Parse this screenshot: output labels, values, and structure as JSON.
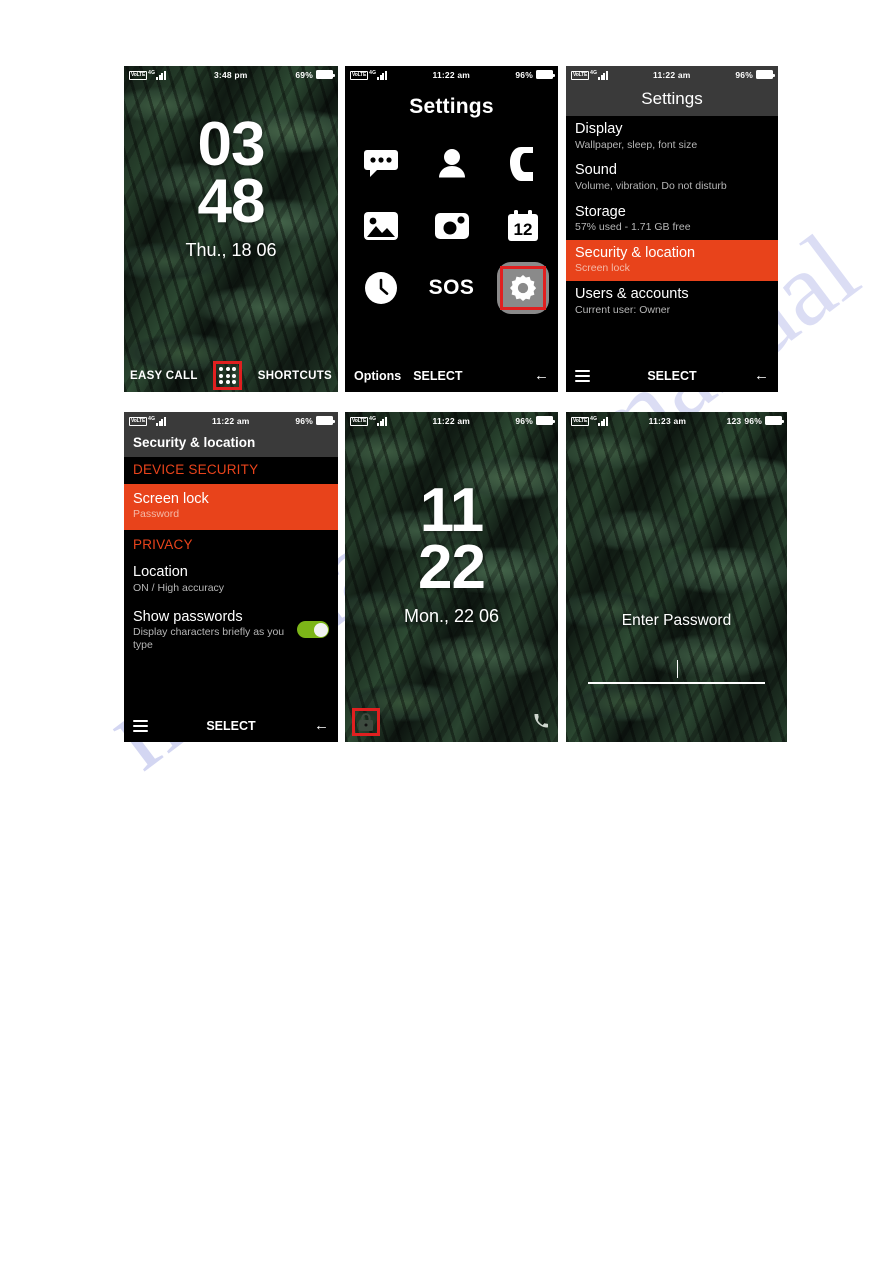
{
  "page": {
    "watermark_text": "manual",
    "accent_red": "#e8431b",
    "highlight_red": "#e02020",
    "toggle_green": "#7cb518"
  },
  "screens": [
    {
      "id": "home-lock-screen",
      "name": "home-screen",
      "status": {
        "network": "VoLTE",
        "net_type": "4G",
        "time": "3:48 pm",
        "battery_percent": "69%"
      },
      "clock": {
        "hours": "03",
        "minutes": "48",
        "date": "Thu., 18 06"
      },
      "softkeys": {
        "left": "EASY CALL",
        "center_icon": "app-grid-icon",
        "right": "SHORTCUTS"
      }
    },
    {
      "id": "settings-app-grid",
      "name": "settings-grid-screen",
      "status": {
        "network": "VoLTE",
        "net_type": "4G",
        "time": "11:22 am",
        "battery_percent": "96%"
      },
      "title": "Settings",
      "apps": [
        {
          "label": "Messages",
          "icon": "message-bubble-icon",
          "selected": false
        },
        {
          "label": "Contacts",
          "icon": "person-icon",
          "selected": false
        },
        {
          "label": "Phone",
          "icon": "phone-handset-icon",
          "selected": false
        },
        {
          "label": "Gallery",
          "icon": "photo-image-icon",
          "selected": false
        },
        {
          "label": "Camera",
          "icon": "camera-icon",
          "selected": false
        },
        {
          "label": "Calendar",
          "icon": "calendar-icon",
          "icon_text": "12",
          "selected": false
        },
        {
          "label": "Clock",
          "icon": "clock-icon",
          "selected": false
        },
        {
          "label": "SOS",
          "icon": "sos-text-icon",
          "icon_text": "SOS",
          "selected": false
        },
        {
          "label": "Settings",
          "icon": "gear-icon",
          "selected": true
        }
      ],
      "softkeys": {
        "left": "Options",
        "center": "SELECT",
        "right_icon": "back-arrow-icon"
      }
    },
    {
      "id": "settings-list",
      "name": "settings-list-screen",
      "status": {
        "network": "VoLTE",
        "net_type": "4G",
        "time": "11:22 am",
        "battery_percent": "96%"
      },
      "title": "Settings",
      "items": [
        {
          "title": "Display",
          "subtitle": "Wallpaper, sleep, font size",
          "selected": false
        },
        {
          "title": "Sound",
          "subtitle": "Volume, vibration, Do not disturb",
          "selected": false
        },
        {
          "title": "Storage",
          "subtitle": "57% used - 1.71 GB free",
          "selected": false
        },
        {
          "title": "Security & location",
          "subtitle": "Screen lock",
          "selected": true
        },
        {
          "title": "Users & accounts",
          "subtitle": "Current user: Owner",
          "selected": false
        }
      ],
      "softkeys": {
        "left_icon": "hamburger-menu-icon",
        "center": "SELECT",
        "right_icon": "back-arrow-icon"
      }
    },
    {
      "id": "security-location",
      "name": "security-location-screen",
      "status": {
        "network": "VoLTE",
        "net_type": "4G",
        "time": "11:22 am",
        "battery_percent": "96%"
      },
      "title": "Security & location",
      "items": [
        {
          "title": "DEVICE SECURITY",
          "subtitle": "",
          "section": true,
          "selected": false
        },
        {
          "title": "Screen lock",
          "subtitle": "Password",
          "selected": true
        },
        {
          "title": "PRIVACY",
          "subtitle": "",
          "section": true,
          "selected": false
        },
        {
          "title": "Location",
          "subtitle": "ON / High accuracy",
          "selected": false
        },
        {
          "title": "Show passwords",
          "subtitle": "Display characters briefly as you type",
          "toggle": "on",
          "selected": false
        }
      ],
      "softkeys": {
        "left_icon": "hamburger-menu-icon",
        "center": "SELECT",
        "right_icon": "back-arrow-icon"
      }
    },
    {
      "id": "locked-screen",
      "name": "locked-home-screen",
      "status": {
        "network": "VoLTE",
        "net_type": "4G",
        "time": "11:22 am",
        "battery_percent": "96%"
      },
      "clock": {
        "hours": "11",
        "minutes": "22",
        "date": "Mon., 22 06"
      },
      "softkeys": {
        "left_icon": "lock-icon",
        "right_icon": "phone-handset-icon"
      }
    },
    {
      "id": "enter-password",
      "name": "enter-password-screen",
      "status": {
        "network": "VoLTE",
        "net_type": "4G",
        "time": "11:23 am",
        "extra": "123",
        "battery_percent": "96%"
      },
      "prompt": "Enter Password",
      "input_value": "",
      "input_placeholder": ""
    }
  ]
}
